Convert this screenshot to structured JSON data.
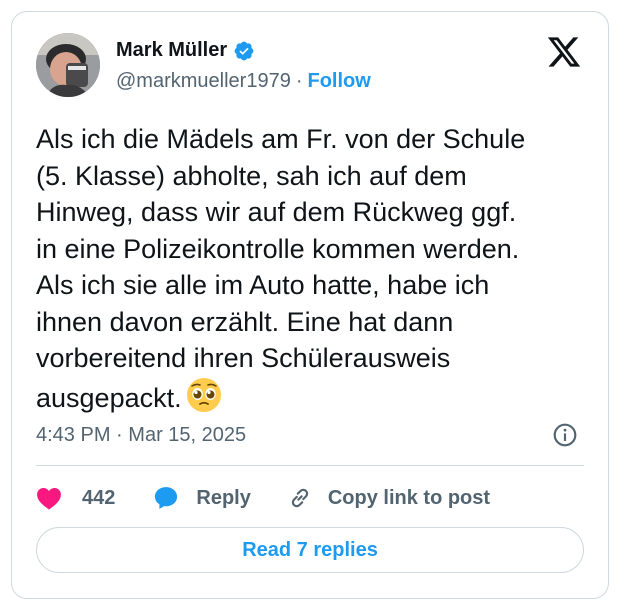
{
  "tweet": {
    "author_name": "Mark Müller",
    "handle": "@markmueller1979",
    "separator": "·",
    "follow_label": "Follow",
    "text": "Als ich die Mädels am Fr. von der Schule\n(5. Klasse) abholte, sah ich auf dem\nHinweg, dass wir auf dem Rückweg ggf.\nin eine Polizeikontrolle kommen werden.\nAls ich sie alle im Auto hatte, habe ich\nihnen davon erzählt. Eine hat dann\nvorbereitend ihren Schülerausweis\nausgepackt.",
    "emoji": "pleading-face-emoji",
    "time": "4:43 PM",
    "date": "Mar 15, 2025",
    "meta_separator": "·"
  },
  "actions": {
    "like_count": "442",
    "reply_label": "Reply",
    "copy_label": "Copy link to post"
  },
  "read_replies_label": "Read 7 replies",
  "icons": {
    "verified": "verified-badge-icon",
    "logo": "x-logo-icon",
    "info": "info-icon",
    "like": "heart-icon",
    "reply": "speech-bubble-icon",
    "copy": "link-icon"
  },
  "colors": {
    "accent": "#1d9bf0",
    "like": "#f91880",
    "text": "#0f1419",
    "muted": "#536471",
    "border": "#cfd9de"
  }
}
